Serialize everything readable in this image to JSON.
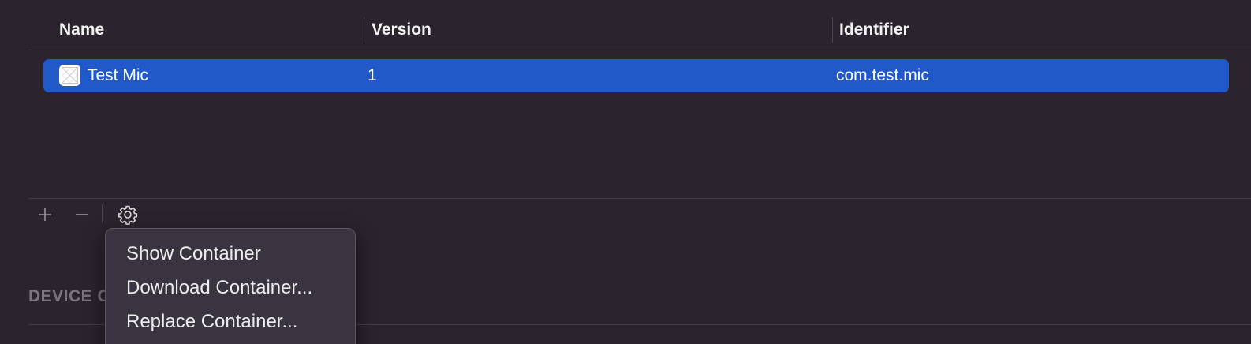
{
  "table": {
    "columns": [
      {
        "label": "Name"
      },
      {
        "label": "Version"
      },
      {
        "label": "Identifier"
      }
    ],
    "rows": [
      {
        "name": "Test Mic",
        "version": "1",
        "identifier": "com.test.mic",
        "icon": "app-placeholder-icon",
        "selected": true
      }
    ]
  },
  "toolbar": {
    "add_icon": "plus-icon",
    "remove_icon": "minus-icon",
    "actions_icon": "gear-icon"
  },
  "section": {
    "label": "DEVICE C"
  },
  "context_menu": {
    "items": [
      {
        "label": "Show Container"
      },
      {
        "label": "Download Container..."
      },
      {
        "label": "Replace Container..."
      }
    ]
  },
  "colors": {
    "background": "#2b232d",
    "selection": "#2259c9",
    "menu_background": "#3a3340"
  }
}
